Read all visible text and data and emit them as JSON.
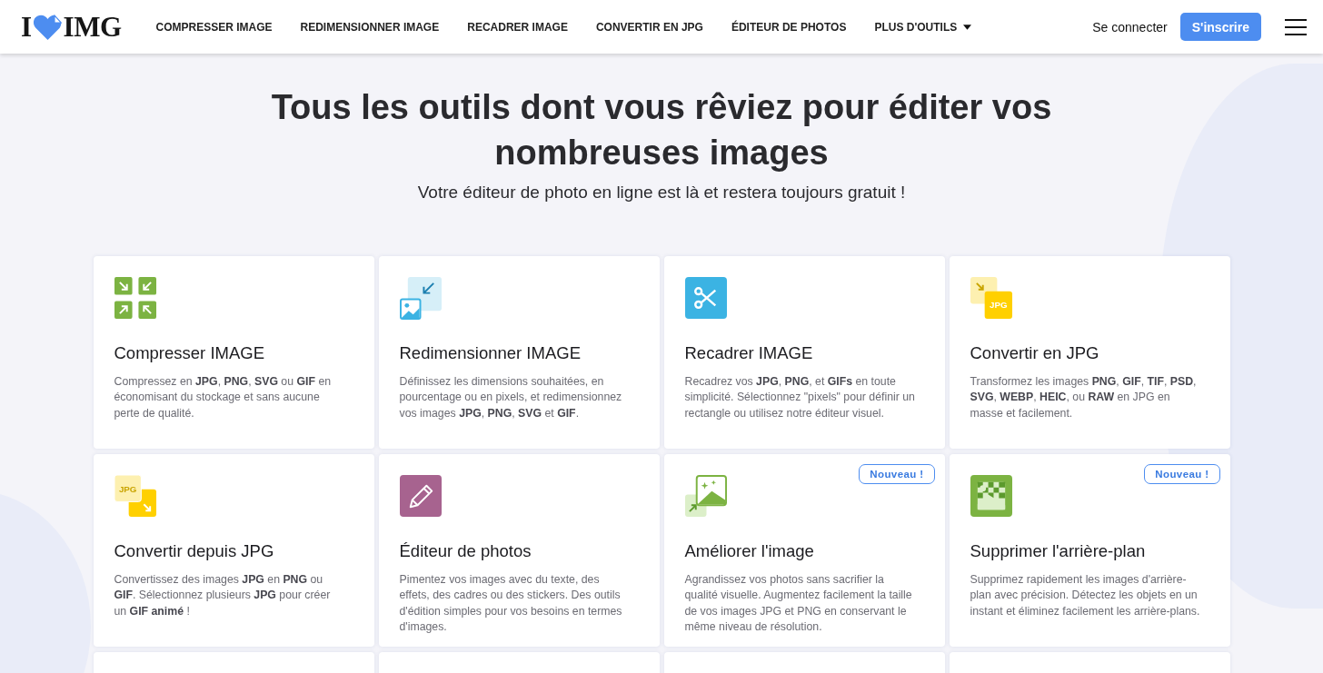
{
  "logo": {
    "left": "I",
    "right": "IMG"
  },
  "nav": [
    {
      "label": "COMPRESSER IMAGE",
      "dropdown": false
    },
    {
      "label": "REDIMENSIONNER IMAGE",
      "dropdown": false
    },
    {
      "label": "RECADRER IMAGE",
      "dropdown": false
    },
    {
      "label": "CONVERTIR EN JPG",
      "dropdown": false
    },
    {
      "label": "ÉDITEUR DE PHOTOS",
      "dropdown": false
    },
    {
      "label": "PLUS D'OUTILS",
      "dropdown": true
    }
  ],
  "login": "Se connecter",
  "signup": "S'inscrire",
  "hero": {
    "title": "Tous les outils dont vous rêviez pour éditer vos nombreuses images",
    "subtitle": "Votre éditeur de photo en ligne est là et restera toujours gratuit !"
  },
  "tools": [
    {
      "kind": "compress",
      "title": "Compresser IMAGE",
      "description": "Compressez en **JPG**, **PNG**, **SVG** ou **GIF** en économisant du stockage et sans aucune perte de qualité."
    },
    {
      "kind": "resize",
      "title": "Redimensionner IMAGE",
      "description": "Définissez les dimensions souhaitées, en pourcentage ou en pixels, et redimensionnez vos images **JPG**, **PNG**, **SVG** et **GIF**."
    },
    {
      "kind": "crop",
      "title": "Recadrer IMAGE",
      "description": "Recadrez vos **JPG**, **PNG**, et **GIFs** en toute simplicité. Sélectionnez \"pixels\" pour définir un rectangle ou utilisez notre éditeur visuel."
    },
    {
      "kind": "to-jpg",
      "icon_label": "JPG",
      "title": "Convertir en JPG",
      "description": "Transformez les images **PNG**, **GIF**, **TIF**, **PSD**, **SVG**, **WEBP**, **HEIC**, ou **RAW** en JPG en masse et facilement."
    },
    {
      "kind": "from-jpg",
      "icon_label": "JPG",
      "title": "Convertir depuis JPG",
      "description": "Convertissez des images **JPG** en **PNG** ou **GIF**. Sélectionnez plusieurs **JPG** pour créer un **GIF animé** !"
    },
    {
      "kind": "editor",
      "title": "Éditeur de photos",
      "description": "Pimentez vos images avec du texte, des effets, des cadres ou des stickers. Des outils d'édition simples pour vos besoins en termes d'images."
    },
    {
      "kind": "upscale",
      "badge": "Nouveau !",
      "title": "Améliorer l'image",
      "description": "Agrandissez vos photos sans sacrifier la qualité visuelle. Augmentez facilement la taille de vos images JPG et PNG en conservant le même niveau de résolution."
    },
    {
      "kind": "remove-bg",
      "badge": "Nouveau !",
      "title": "Supprimer l'arrière-plan",
      "description": "Supprimez rapidement les images d'arrière-plan avec précision. Détectez les objets en un instant et éliminez facilement les arrière-plans."
    }
  ]
}
